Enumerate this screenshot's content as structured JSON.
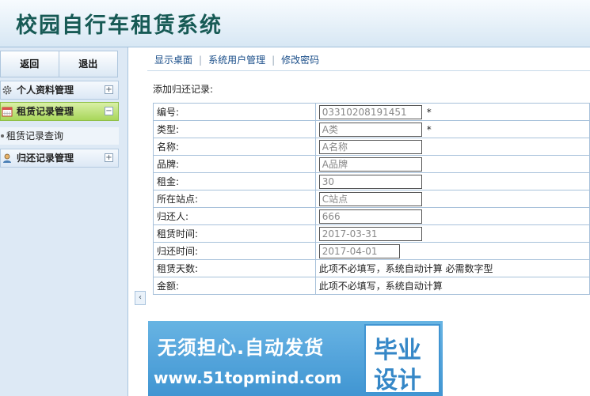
{
  "app": {
    "title": "校园自行车租赁系统"
  },
  "sidebar": {
    "back_label": "返回",
    "logout_label": "退出",
    "groups": [
      {
        "label": "个人资料管理",
        "toggle": "+"
      },
      {
        "label": "租赁记录管理",
        "toggle": "−",
        "submenu": [
          "租赁记录查询"
        ]
      },
      {
        "label": "归还记录管理",
        "toggle": "+"
      }
    ],
    "collapse": "‹"
  },
  "nav": {
    "links": [
      "显示桌面",
      "系统用户管理",
      "修改密码"
    ],
    "sep": "|"
  },
  "form": {
    "title": "添加归还记录:",
    "rows": [
      {
        "label": "编号:",
        "value": "03310208191451",
        "required": "*"
      },
      {
        "label": "类型:",
        "value": "A类",
        "required": "*"
      },
      {
        "label": "名称:",
        "value": "A名称"
      },
      {
        "label": "品牌:",
        "value": "A品牌"
      },
      {
        "label": "租金:",
        "value": "30"
      },
      {
        "label": "所在站点:",
        "value": "C站点"
      },
      {
        "label": "归还人:",
        "value": "666"
      },
      {
        "label": "租赁时间:",
        "value": "2017-03-31"
      },
      {
        "label": "归还时间:",
        "value": "2017-04-01"
      },
      {
        "label": "租赁天数:",
        "text": "此项不必填写，系统自动计算 必需数字型"
      },
      {
        "label": "金额:",
        "text": "此项不必填写，系统自动计算"
      }
    ]
  },
  "watermark": {
    "slogan": "无须担心.自动发货",
    "url": "www.51topmind.com",
    "box_line1": "毕业",
    "box_line2": "设计"
  }
}
